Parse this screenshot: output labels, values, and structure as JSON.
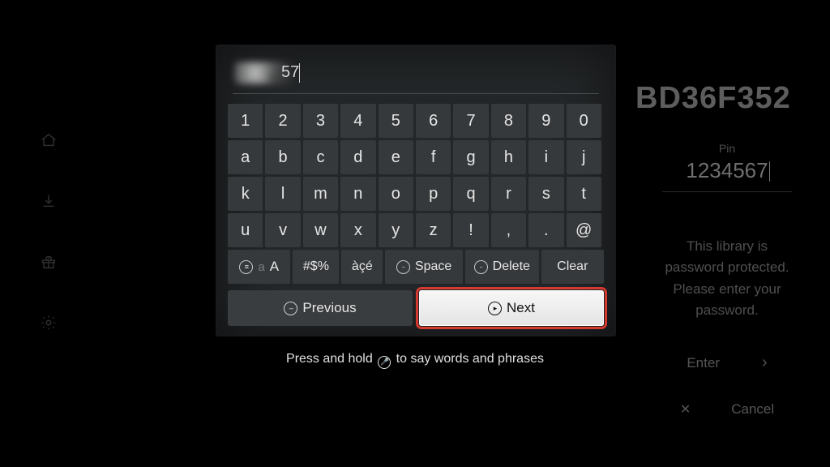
{
  "rail": {
    "icons": [
      "home-icon",
      "download-icon",
      "gift-icon",
      "settings-icon"
    ]
  },
  "context": {
    "device_id": "BD36F352",
    "pin_label": "Pin",
    "pin_value": "1234567",
    "message": "This library is\npassword protected.\nPlease enter your\npassword.",
    "enter_label": "Enter",
    "cancel_label": "Cancel"
  },
  "input": {
    "visible_trailing": "57"
  },
  "keyboard": {
    "row1": [
      "1",
      "2",
      "3",
      "4",
      "5",
      "6",
      "7",
      "8",
      "9",
      "0"
    ],
    "row2": [
      "a",
      "b",
      "c",
      "d",
      "e",
      "f",
      "g",
      "h",
      "i",
      "j"
    ],
    "row3": [
      "k",
      "l",
      "m",
      "n",
      "o",
      "p",
      "q",
      "r",
      "s",
      "t"
    ],
    "row4": [
      "u",
      "v",
      "w",
      "x",
      "y",
      "z",
      "!",
      ",",
      ".",
      "@"
    ],
    "func": {
      "shift_small": "aA",
      "symbols": "#$%",
      "accents": "àçé",
      "space": "Space",
      "delete": "Delete",
      "clear": "Clear"
    },
    "nav": {
      "previous": "Previous",
      "next": "Next"
    }
  },
  "hint": {
    "prefix": "Press and hold ",
    "suffix": " to say words and phrases"
  }
}
